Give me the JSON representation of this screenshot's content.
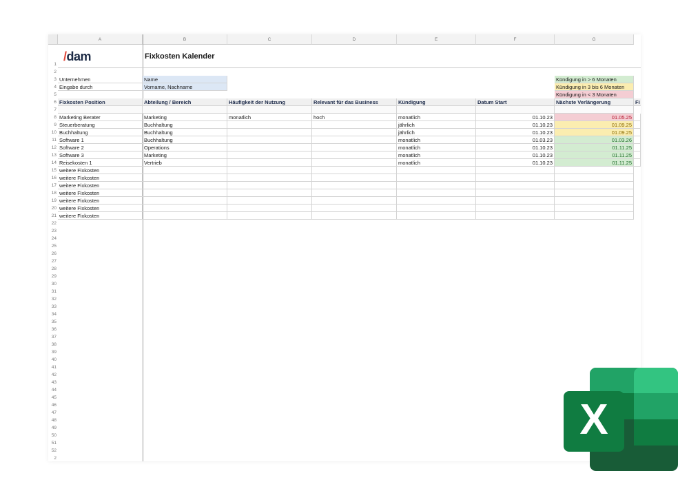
{
  "columns": [
    "A",
    "B",
    "C",
    "D",
    "E",
    "F",
    "G"
  ],
  "row_numbers": [
    "1",
    "2",
    "3",
    "4",
    "5",
    "6",
    "7",
    "8",
    "9",
    "10",
    "11",
    "12",
    "13",
    "14",
    "15",
    "16",
    "17",
    "18",
    "19",
    "20",
    "21",
    "22",
    "23",
    "24",
    "25",
    "26",
    "27",
    "28",
    "29",
    "30",
    "31",
    "32",
    "33",
    "34",
    "35",
    "36",
    "37",
    "38",
    "39",
    "40",
    "41",
    "42",
    "43",
    "44",
    "45",
    "46",
    "47",
    "48",
    "49",
    "50",
    "51",
    "52",
    "2"
  ],
  "logo": {
    "accent": "/",
    "rest": "dam"
  },
  "title": "Fixkosten Kalender",
  "meta": {
    "company_label": "Unternehmen",
    "company_value": "Name",
    "input_label": "Eingabe durch",
    "input_value": "Vorname, Nachname"
  },
  "legend": [
    {
      "label": "Kündigung in > 6 Monaten",
      "color": "#d3ecd1"
    },
    {
      "label": "Kündigung in 3 bis 6 Monaten",
      "color": "#fbedb0"
    },
    {
      "label": "Kündigung in < 3 Monaten",
      "color": "#f4cdd3"
    }
  ],
  "headers": [
    "Fixkosten Position",
    "Abteilung / Bereich",
    "Häufigkeit der Nutzung",
    "Relevant für das Business",
    "Kündigung",
    "Datum Start",
    "Nächste Verlängerung",
    "Fi"
  ],
  "rows": [
    {
      "position": "Marketing Berater",
      "abteilung": "Marketing",
      "haeufigkeit": "monatlich",
      "relevant": "hoch",
      "kuendigung": "monatlich",
      "start": "01.10.23",
      "verlaengerung": "01.05.25",
      "status": "red"
    },
    {
      "position": "Steuerberatung",
      "abteilung": "Buchhaltung",
      "haeufigkeit": "",
      "relevant": "",
      "kuendigung": "jährlich",
      "start": "01.10.23",
      "verlaengerung": "01.09.25",
      "status": "yellow"
    },
    {
      "position": "Buchhaltung",
      "abteilung": "Buchhaltung",
      "haeufigkeit": "",
      "relevant": "",
      "kuendigung": "jährlich",
      "start": "01.10.23",
      "verlaengerung": "01.09.25",
      "status": "yellow"
    },
    {
      "position": "Software 1",
      "abteilung": "Buchhaltung",
      "haeufigkeit": "",
      "relevant": "",
      "kuendigung": "monatlich",
      "start": "01.03.23",
      "verlaengerung": "01.03.26",
      "status": "green"
    },
    {
      "position": "Software 2",
      "abteilung": "Operations",
      "haeufigkeit": "",
      "relevant": "",
      "kuendigung": "monatlich",
      "start": "01.10.23",
      "verlaengerung": "01.11.25",
      "status": "green"
    },
    {
      "position": "Software 3",
      "abteilung": "Marketing",
      "haeufigkeit": "",
      "relevant": "",
      "kuendigung": "monatlich",
      "start": "01.10.23",
      "verlaengerung": "01.11.25",
      "status": "green"
    },
    {
      "position": "Reisekosten 1",
      "abteilung": "Vertrieb",
      "haeufigkeit": "",
      "relevant": "",
      "kuendigung": "monatlich",
      "start": "01.10.23",
      "verlaengerung": "01.11.25",
      "status": "green"
    }
  ],
  "placeholder_rows": [
    "weitere Fixkosten",
    "weitere Fixkosten",
    "weitere Fixkosten",
    "weitere Fixkosten",
    "weitere Fixkosten",
    "weitere Fixkosten",
    "weitere Fixkosten"
  ],
  "status_colors": {
    "red": {
      "bg": "#f4cdd3",
      "fg": "#b4162e"
    },
    "yellow": {
      "bg": "#fbedb0",
      "fg": "#8a6a00"
    },
    "green": {
      "bg": "#d3ecd1",
      "fg": "#1f6e2a"
    }
  },
  "excel_icon": {
    "name": "excel-icon",
    "letter": "X"
  }
}
